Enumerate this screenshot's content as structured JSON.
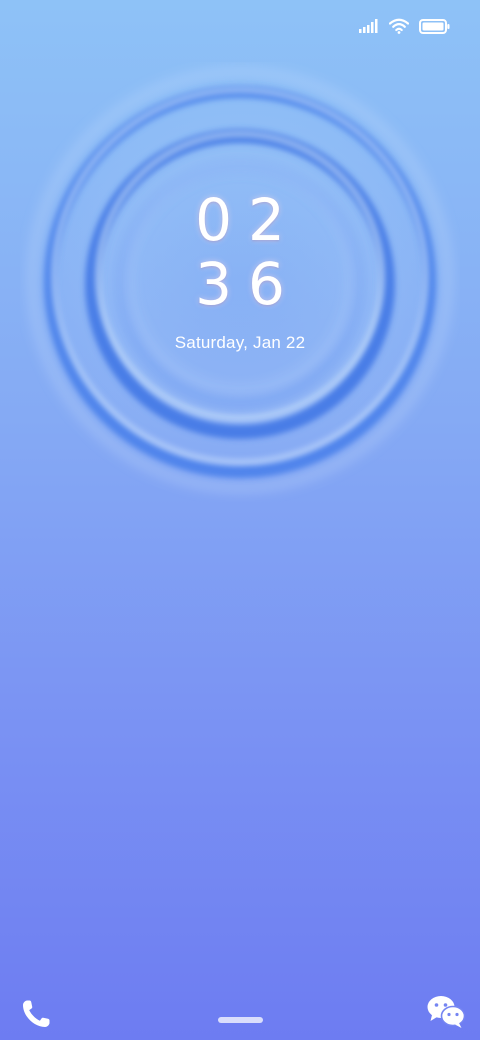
{
  "status_bar": {
    "icons": [
      "signal-icon",
      "wifi-icon",
      "battery-icon"
    ]
  },
  "clock": {
    "hours": "02",
    "minutes": "36"
  },
  "date": "Saturday, Jan 22",
  "shortcuts": {
    "left_icon": "phone-icon",
    "right_icon": "wechat-icon"
  },
  "colors": {
    "background_top": "#8ec2f7",
    "background_bottom": "#6d7cf2",
    "ripple": "#3f78e8",
    "text": "#ffffff"
  }
}
